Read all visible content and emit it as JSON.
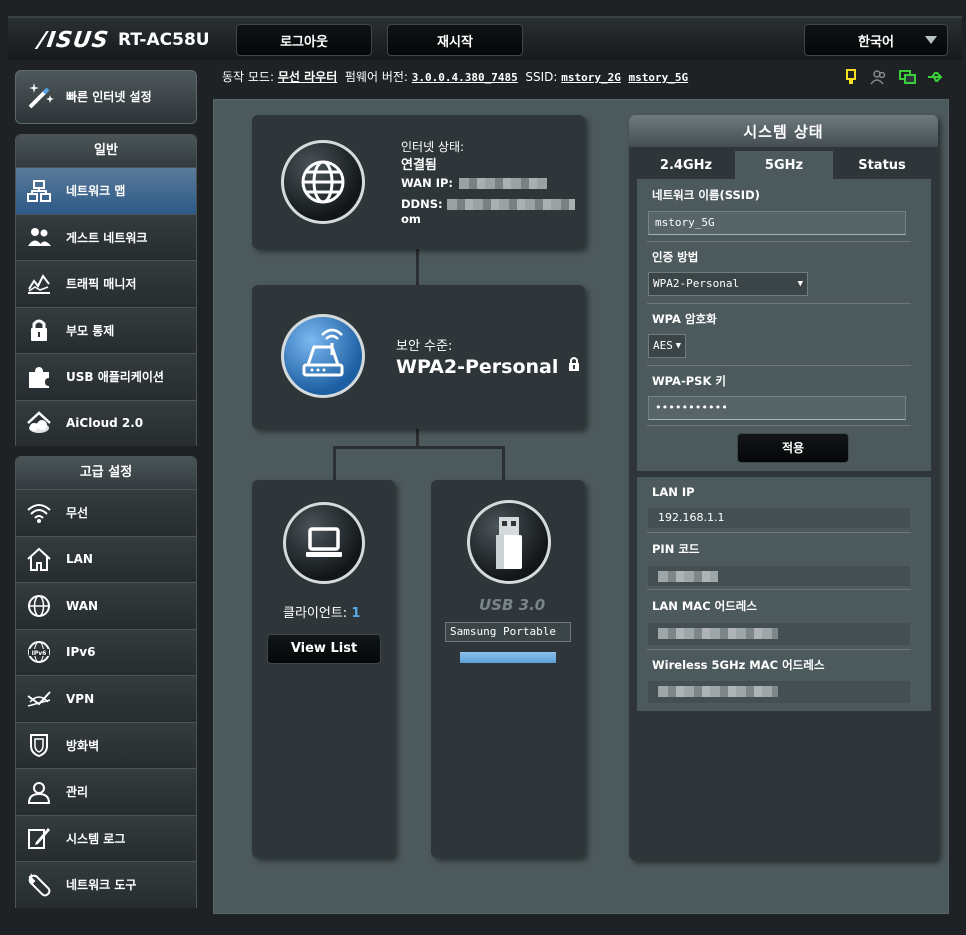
{
  "header": {
    "brand": "/ISUS",
    "model": "RT-AC58U",
    "logout_label": "로그아웃",
    "restart_label": "재시작",
    "language": "한국어"
  },
  "status_bar": {
    "mode_label": "동작 모드:",
    "mode_value": "무선 라우터",
    "firmware_label": "펌웨어 버전:",
    "firmware_value": "3.0.0.4.380_7485",
    "ssid_label": "SSID:",
    "ssid_2g": "mstory_2G",
    "ssid_5g": "mstory_5G"
  },
  "sidebar": {
    "quick_setup": "빠른 인터넷 설정",
    "general_title": "일반",
    "general_items": [
      {
        "label": "네트워크 맵"
      },
      {
        "label": "게스트 네트워크"
      },
      {
        "label": "트래픽 매니저"
      },
      {
        "label": "부모 통제"
      },
      {
        "label": "USB 애플리케이션"
      },
      {
        "label": "AiCloud 2.0"
      }
    ],
    "advanced_title": "고급 설정",
    "advanced_items": [
      {
        "label": "무선"
      },
      {
        "label": "LAN"
      },
      {
        "label": "WAN"
      },
      {
        "label": "IPv6"
      },
      {
        "label": "VPN"
      },
      {
        "label": "방화벽"
      },
      {
        "label": "관리"
      },
      {
        "label": "시스템 로그"
      },
      {
        "label": "네트워크 도구"
      }
    ]
  },
  "network_map": {
    "internet_status_label": "인터넷 상태:",
    "internet_status_value": "연결됨",
    "wan_ip_label": "WAN IP:",
    "ddns_label": "DDNS:",
    "ddns_suffix": "om",
    "security_label": "보안 수준:",
    "security_value": "WPA2-Personal",
    "clients_label": "클라이언트:",
    "clients_count": "1",
    "view_list_label": "View List",
    "usb_label": "USB 3.0",
    "usb_device": "Samsung Portable"
  },
  "system_status": {
    "title": "시스템 상태",
    "tabs": [
      "2.4GHz",
      "5GHz",
      "Status"
    ],
    "ssid_label": "네트워크 이름(SSID)",
    "ssid_value": "mstory_5G",
    "auth_label": "인증 방법",
    "auth_value": "WPA2-Personal",
    "encryption_label": "WPA 암호화",
    "encryption_value": "AES",
    "psk_label": "WPA-PSK 키",
    "psk_value": "•••••••••••",
    "apply_label": "적용",
    "lan_ip_label": "LAN IP",
    "lan_ip_value": "192.168.1.1",
    "pin_label": "PIN 코드",
    "lan_mac_label": "LAN MAC 어드레스",
    "wireless_mac_label": "Wireless 5GHz MAC 어드레스"
  },
  "colors": {
    "accent": "#2d5a88",
    "background": "#1e2224",
    "panel": "#2e3639",
    "main": "#4d5a5d",
    "client_count": "#5aa9e6"
  }
}
